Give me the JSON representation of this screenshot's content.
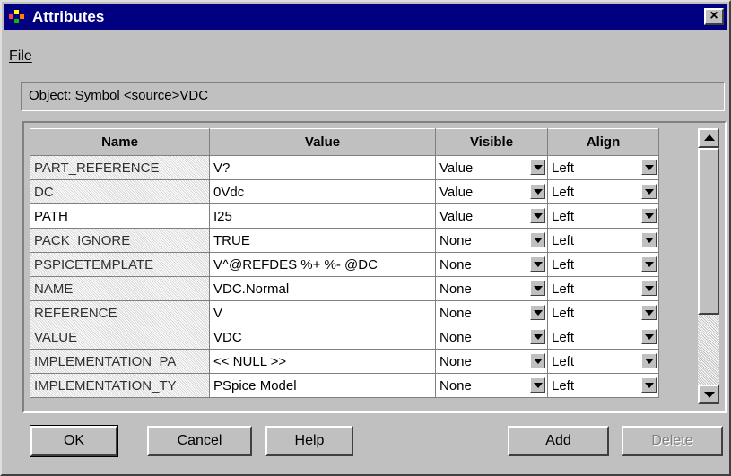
{
  "window": {
    "title": "Attributes",
    "close_label": "×"
  },
  "menu": {
    "file_label": "File"
  },
  "object_line": "Object:  Symbol <source>VDC",
  "grid": {
    "headers": [
      "Name",
      "Value",
      "Visible",
      "Align"
    ],
    "rows": [
      {
        "name": "PART_REFERENCE",
        "value": "V?",
        "visible": "Value",
        "align": "Left"
      },
      {
        "name": "DC",
        "value": "0Vdc",
        "visible": "Value",
        "align": "Left"
      },
      {
        "name": "PATH",
        "value": "I25",
        "visible": "Value",
        "align": "Left"
      },
      {
        "name": "PACK_IGNORE",
        "value": "TRUE",
        "visible": "None",
        "align": "Left"
      },
      {
        "name": "PSPICETEMPLATE",
        "value": "V^@REFDES %+ %- @DC",
        "visible": "None",
        "align": "Left"
      },
      {
        "name": "NAME",
        "value": "VDC.Normal",
        "visible": "None",
        "align": "Left"
      },
      {
        "name": "REFERENCE",
        "value": "V",
        "visible": "None",
        "align": "Left"
      },
      {
        "name": "VALUE",
        "value": "VDC",
        "visible": "None",
        "align": "Left"
      },
      {
        "name": "IMPLEMENTATION_PA",
        "value": "<< NULL >>",
        "visible": "None",
        "align": "Left"
      },
      {
        "name": "IMPLEMENTATION_TY",
        "value": "PSpice Model",
        "visible": "None",
        "align": "Left"
      }
    ]
  },
  "buttons": {
    "ok": "OK",
    "cancel": "Cancel",
    "help": "Help",
    "add": "Add",
    "delete": "Delete"
  }
}
